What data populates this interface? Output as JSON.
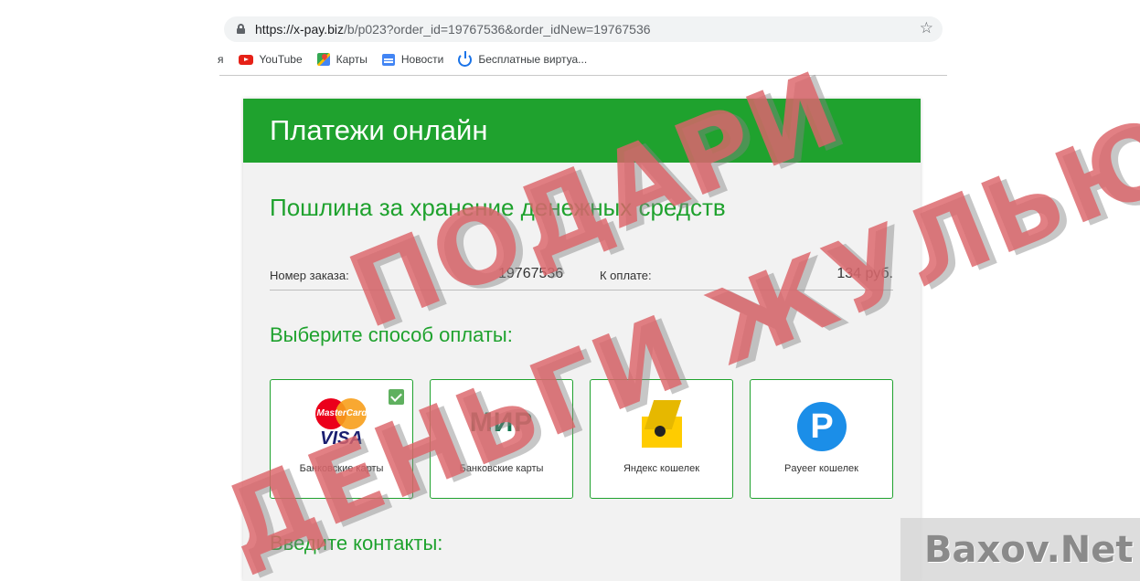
{
  "browser": {
    "url_host": "https://x-pay.biz",
    "url_rest": "/b/p023?order_id=19767536&order_idNew=19767536",
    "bookmarks": [
      {
        "label": "я",
        "icon": "partial-bookmark"
      },
      {
        "label": "YouTube",
        "icon": "youtube-icon"
      },
      {
        "label": "Карты",
        "icon": "maps-icon"
      },
      {
        "label": "Новости",
        "icon": "news-icon"
      },
      {
        "label": "Бесплатные виртуа...",
        "icon": "power-icon"
      }
    ]
  },
  "page": {
    "header_title": "Платежи онлайн",
    "subtitle": "Пошлина за хранение денежных средств",
    "order_label": "Номер заказа:",
    "order_value": "19767536",
    "pay_label": "К оплате:",
    "pay_value": "134 руб.",
    "choose_method": "Выберите способ оплаты:",
    "methods": [
      {
        "label": "Банковские карты",
        "logo": "mastercard-visa",
        "selected": true
      },
      {
        "label": "Банковские карты",
        "logo": "mir"
      },
      {
        "label": "Яндекс кошелек",
        "logo": "yandex-money"
      },
      {
        "label": "Payeer кошелек",
        "logo": "payeer"
      }
    ],
    "mastercard_text": "MasterCard",
    "visa_text": "VISA",
    "mir_text": "МИР",
    "payeer_letter": "P",
    "contacts_title": "Введите контакты:"
  },
  "overlay": {
    "stamp_line1": "ПОДАРИ",
    "stamp_line2": "ДЕНЬГИ ЖУЛЬЮ",
    "watermark": "Baxov.Net"
  },
  "colors": {
    "brand_green": "#1fa22e",
    "stamp_red": "#dc6469"
  }
}
